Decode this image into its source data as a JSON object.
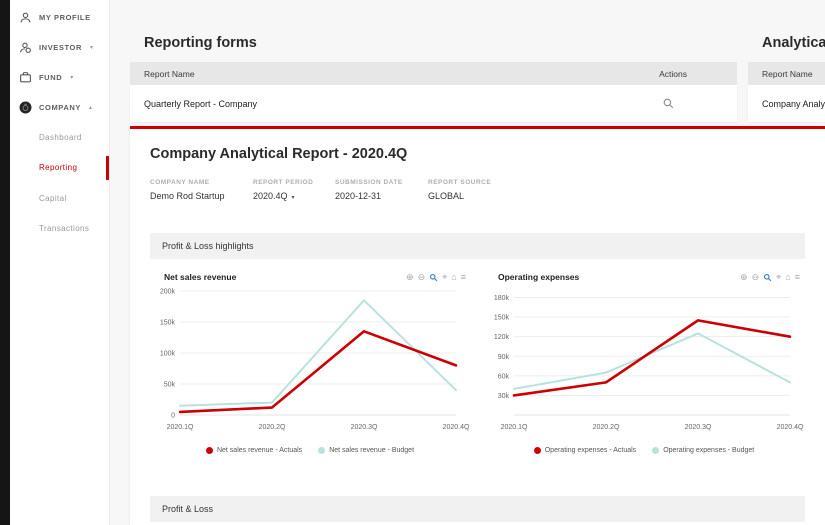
{
  "colors": {
    "accent_red": "#cc0000",
    "budget_teal": "#b9e2de",
    "zoom_blue": "#3d7bc8"
  },
  "icons": {
    "zoom_in": "⊕",
    "zoom_out": "⊖",
    "pan": "⌖",
    "home": "⌂",
    "menu": "≡",
    "caret_down": "▾",
    "caret_up": "▴",
    "select_caret": "▾"
  },
  "sidebar": {
    "items": [
      {
        "label": "MY PROFILE"
      },
      {
        "label": "INVESTOR"
      },
      {
        "label": "FUND"
      },
      {
        "label": "COMPANY"
      }
    ],
    "company_subitems": [
      {
        "label": "Dashboard"
      },
      {
        "label": "Reporting"
      },
      {
        "label": "Capital"
      },
      {
        "label": "Transactions"
      }
    ]
  },
  "reporting_forms": {
    "title": "Reporting forms",
    "col_report_name": "Report Name",
    "col_actions": "Actions",
    "row_name": "Quarterly Report - Company"
  },
  "analytical_reports": {
    "title": "Analytical re",
    "col_report_name": "Report Name",
    "row_name": "Company Analyt"
  },
  "report": {
    "title": "Company Analytical Report - 2020.4Q",
    "fields": [
      {
        "label": "COMPANY NAME",
        "value": "Demo Rod Startup"
      },
      {
        "label": "REPORT PERIOD",
        "value": "2020.4Q"
      },
      {
        "label": "SUBMISSION DATE",
        "value": "2020-12-31"
      },
      {
        "label": "REPORT SOURCE",
        "value": "GLOBAL"
      }
    ],
    "section_highlights": "Profit & Loss highlights",
    "section_pl": "Profit & Loss"
  },
  "chart_data": [
    {
      "type": "line",
      "title": "Net sales revenue",
      "x": [
        "2020.1Q",
        "2020.2Q",
        "2020.3Q",
        "2020.4Q"
      ],
      "series": [
        {
          "name": "Net sales revenue - Actuals",
          "color": "#cc0000",
          "values": [
            5000,
            12000,
            135000,
            80000
          ]
        },
        {
          "name": "Net sales revenue - Budget",
          "color": "#b9e2de",
          "values": [
            15000,
            20000,
            185000,
            40000
          ]
        }
      ],
      "ylim": [
        0,
        200000
      ],
      "yticks": [
        {
          "v": 0,
          "label": "0"
        },
        {
          "v": 50000,
          "label": "50k"
        },
        {
          "v": 100000,
          "label": "100k"
        },
        {
          "v": 150000,
          "label": "150k"
        },
        {
          "v": 200000,
          "label": "200k"
        }
      ],
      "grid": true,
      "legend_position": "bottom"
    },
    {
      "type": "line",
      "title": "Operating expenses",
      "x": [
        "2020.1Q",
        "2020.2Q",
        "2020.3Q",
        "2020.4Q"
      ],
      "series": [
        {
          "name": "Operating expenses - Actuals",
          "color": "#cc0000",
          "values": [
            30000,
            50000,
            145000,
            120000
          ]
        },
        {
          "name": "Operating expenses - Budget",
          "color": "#b9e2de",
          "values": [
            40000,
            65000,
            125000,
            50000
          ]
        }
      ],
      "ylim": [
        0,
        190000
      ],
      "yticks": [
        {
          "v": 30000,
          "label": "30k"
        },
        {
          "v": 60000,
          "label": "60k"
        },
        {
          "v": 90000,
          "label": "90k"
        },
        {
          "v": 120000,
          "label": "120k"
        },
        {
          "v": 150000,
          "label": "150k"
        },
        {
          "v": 180000,
          "label": "180k"
        }
      ],
      "grid": true,
      "legend_position": "bottom"
    }
  ]
}
